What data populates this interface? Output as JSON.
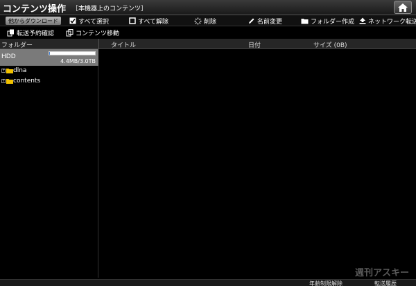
{
  "app": {
    "title": "コンテンツ操作",
    "subtitle": "［本機器上のコンテンツ］"
  },
  "toolbar": {
    "download_label": "他からダウンロード",
    "select_all_label": "すべて選択",
    "deselect_all_label": "すべて解除",
    "delete_label": "削除",
    "rename_label": "名前変更",
    "new_folder_label": "フォルダー作成",
    "network_transfer_label": "ネットワーク転送"
  },
  "subbar": {
    "transfer_confirm_label": "転送予約確認",
    "move_content_label": "コンテンツ移動"
  },
  "columns": {
    "folder": "フォルダー",
    "title": "タイトル",
    "date": "日付",
    "size": "サイズ (0B)"
  },
  "storage": {
    "name": "HDD",
    "usage": "4.4MB/3.0TB",
    "used_fraction": 0.0015
  },
  "folders": [
    {
      "name": "dlna"
    },
    {
      "name": "contents"
    }
  ],
  "footer": {
    "age_unlock_label": "年齢制限解除",
    "history_label": "転送履歴"
  },
  "watermark": "週刊アスキー",
  "colors": {
    "folder_icon": "#f2c200",
    "background": "#000000",
    "hdd_row": "#7a7a7a"
  }
}
